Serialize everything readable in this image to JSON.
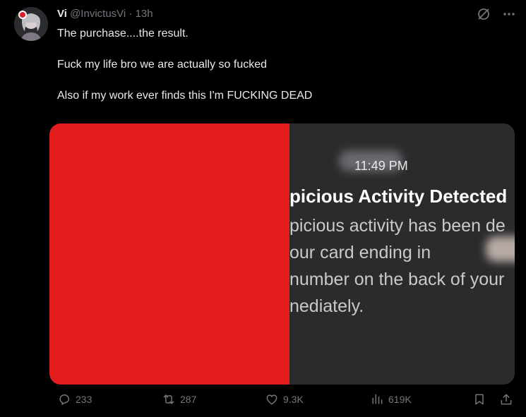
{
  "tweet": {
    "display_name": "Vi",
    "handle": "@InvictusVi",
    "separator": "·",
    "timestamp": "13h",
    "lines": [
      "The purchase....the result.",
      "Fuck my life bro we are actually so fucked",
      "Also if my work ever finds this I'm FUCKING DEAD"
    ]
  },
  "media": {
    "notification_time": "11:49 PM",
    "notification_title": "picious Activity Detected",
    "notification_body": [
      "picious activity has been de",
      "our card ending in",
      "number on the back of your",
      "nediately."
    ],
    "redaction_color": "#e31c1c"
  },
  "actions": {
    "replies": "233",
    "reposts": "287",
    "likes": "9.3K",
    "views": "619K"
  },
  "icons": {
    "top": [
      "grok-icon",
      "more-icon"
    ],
    "actions": [
      "reply-icon",
      "repost-icon",
      "like-icon",
      "views-icon",
      "bookmark-icon",
      "share-icon"
    ]
  }
}
